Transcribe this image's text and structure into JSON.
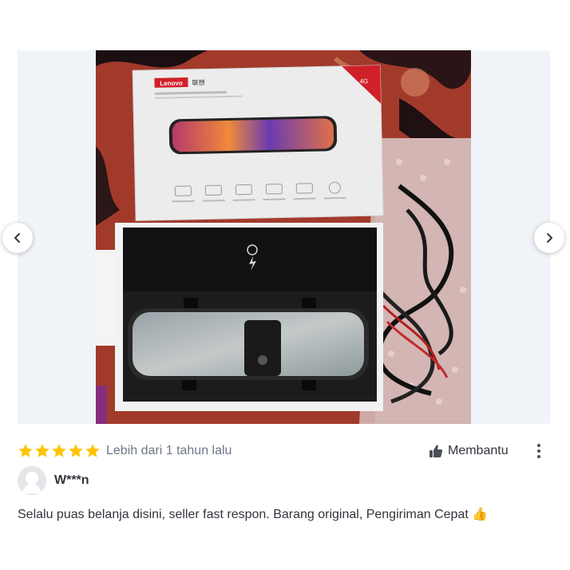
{
  "review": {
    "rating": 5,
    "max_rating": 5,
    "date": "Lebih dari 1 tahun lalu",
    "helpful_label": "Membantu",
    "username": "W***n",
    "text": "Selalu puas belanja disini, seller fast respon. Barang original, Pengiriman Cepat 👍"
  },
  "photo": {
    "box_brand": "Lenovo",
    "box_brand_cn": "联想",
    "badge": "4G"
  },
  "colors": {
    "star": "#ffc400",
    "star_empty": "#e4e6ea",
    "secondary_text": "#6d7588",
    "body_text": "#31353b",
    "accent_red": "#d0202a"
  },
  "icons": {
    "prev": "chevron-left-icon",
    "next": "chevron-right-icon",
    "helpful": "thumbs-up-icon",
    "more": "more-vertical-icon",
    "avatar": "user-avatar-icon",
    "star": "star-icon"
  }
}
